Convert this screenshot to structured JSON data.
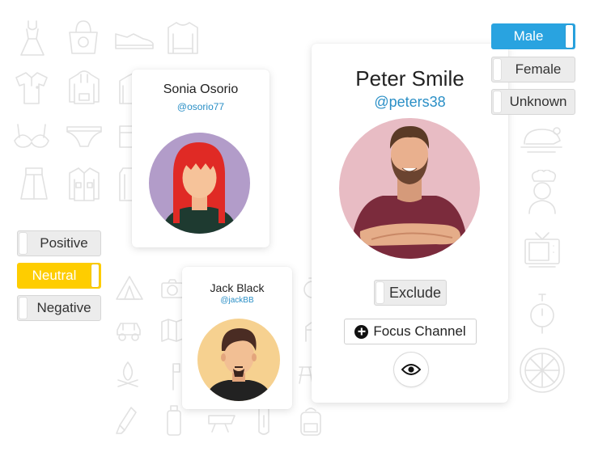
{
  "profiles": {
    "peter": {
      "name": "Peter Smile",
      "handle": "@peters38"
    },
    "sonia": {
      "name": "Sonia Osorio",
      "handle": "@osorio77"
    },
    "jack": {
      "name": "Jack Black",
      "handle": "@jackBB"
    }
  },
  "actions": {
    "exclude_label": "Exclude",
    "focus_label": "Focus Channel",
    "view_icon": "eye-icon",
    "focus_icon": "plus-circle-icon"
  },
  "gender_filter": {
    "options": [
      "Male",
      "Female",
      "Unknown"
    ],
    "selected": "Male",
    "active_color": "#29a3e0"
  },
  "sentiment_filter": {
    "options": [
      "Positive",
      "Neutral",
      "Negative"
    ],
    "selected": "Neutral",
    "active_color": "#fecd00"
  },
  "colors": {
    "handle": "#2a8fc6",
    "peter_avatar_bg": "#e8bcc4",
    "sonia_avatar_bg": "#b29cc9",
    "jack_avatar_bg": "#f6d190"
  },
  "background_icons": [
    "dress-icon",
    "handbag-icon",
    "shoe-icon",
    "sweater-icon",
    "polo-shirt-icon",
    "hoodie-icon",
    "jacket-icon",
    "bra-icon",
    "underwear-icon",
    "skirt-icon",
    "shirt-icon",
    "tent-icon",
    "camera-icon",
    "camper-icon",
    "car-icon",
    "map-icon",
    "campfire-icon",
    "axe-icon",
    "picnic-table-icon",
    "flashlight-icon",
    "flask-icon",
    "knife-icon",
    "carabiner-icon",
    "backpack-icon",
    "turkey-icon",
    "chef-icon",
    "tv-icon",
    "stopwatch-icon",
    "pizza-icon"
  ]
}
